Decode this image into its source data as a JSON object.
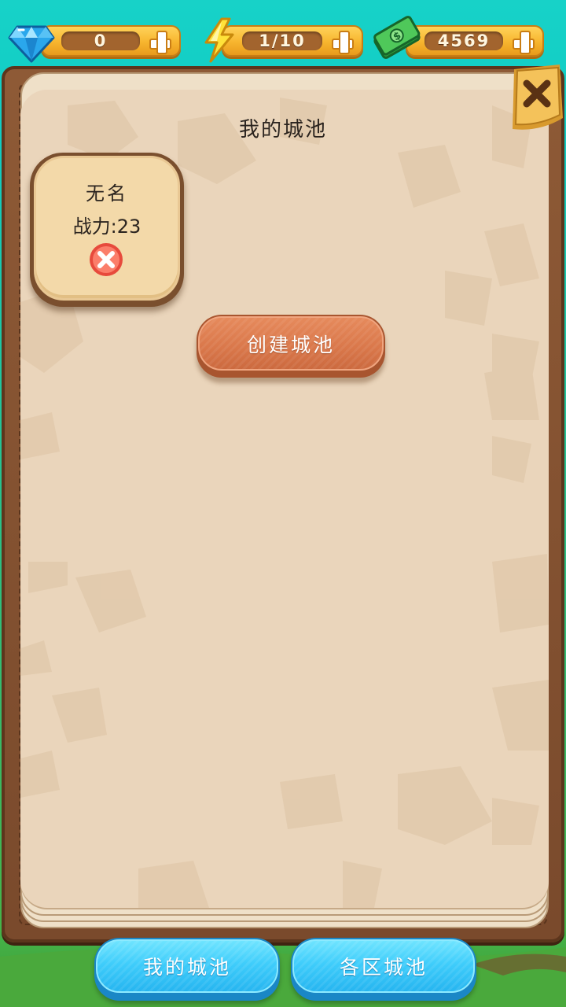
{
  "resources": {
    "gems": {
      "value": "0",
      "icon": "diamond-icon"
    },
    "energy": {
      "value": "1/10",
      "icon": "lightning-icon"
    },
    "money": {
      "value": "4569",
      "icon": "cash-icon"
    }
  },
  "panel": {
    "title": "我的城池",
    "close_icon": "close-x-icon"
  },
  "city_card": {
    "name": "无名",
    "power": "战力:23",
    "delete_icon": "delete-x-circle-icon"
  },
  "create_button": {
    "label": "创建城池"
  },
  "tabs": [
    {
      "label": "我的城池"
    },
    {
      "label": "各区城池"
    }
  ],
  "colors": {
    "sky": "#17d2c8",
    "panel_frame": "#7a4a2c",
    "page": "#ead5bb",
    "create_button": "#d9774a",
    "tab_button": "#3fcdfb",
    "resource_pill": "#f7b52e"
  }
}
